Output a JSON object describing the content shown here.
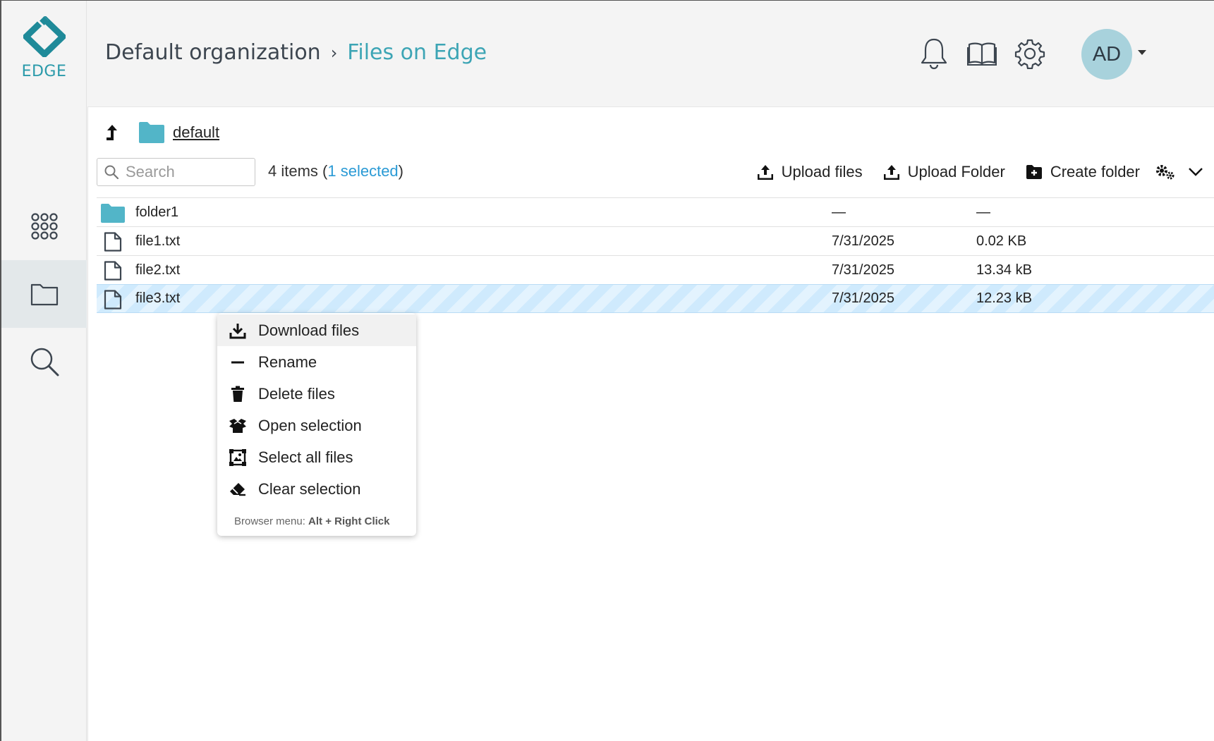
{
  "app": {
    "logo_text": "EDGE",
    "brand_color": "#2a9aaa"
  },
  "sidebar": {
    "items": [
      {
        "icon": "apps-grid-icon",
        "active": false
      },
      {
        "icon": "folder-icon",
        "active": true
      },
      {
        "icon": "search-icon",
        "active": false
      }
    ]
  },
  "header": {
    "breadcrumb_org": "Default organization",
    "breadcrumb_separator": "›",
    "breadcrumb_current": "Files on Edge",
    "icons": [
      "bell-icon",
      "book-icon",
      "gear-icon"
    ],
    "avatar_initials": "AD"
  },
  "pathbar": {
    "folder_name": "default"
  },
  "toolbar": {
    "search_placeholder": "Search",
    "items_count": "4 items",
    "paren_open": "(",
    "selected_label": "1 selected",
    "paren_close": ")",
    "upload_files": "Upload files",
    "upload_folder": "Upload Folder",
    "create_folder": "Create folder"
  },
  "files": [
    {
      "type": "folder",
      "name": "folder1",
      "date": "—",
      "size": "—",
      "selected": false
    },
    {
      "type": "file",
      "name": "file1.txt",
      "date": "7/31/2025",
      "size": "0.02 KB",
      "selected": false
    },
    {
      "type": "file",
      "name": "file2.txt",
      "date": "7/31/2025",
      "size": "13.34 kB",
      "selected": false
    },
    {
      "type": "file",
      "name": "file3.txt",
      "date": "7/31/2025",
      "size": "12.23 kB",
      "selected": true
    }
  ],
  "context_menu": {
    "items": [
      {
        "label": "Download files",
        "icon": "download-icon"
      },
      {
        "label": "Rename",
        "icon": "dash-icon"
      },
      {
        "label": "Delete files",
        "icon": "trash-icon"
      },
      {
        "label": "Open selection",
        "icon": "box-open-icon"
      },
      {
        "label": "Select all files",
        "icon": "select-all-icon"
      },
      {
        "label": "Clear selection",
        "icon": "eraser-icon"
      }
    ],
    "footer_prefix": "Browser menu:",
    "footer_shortcut": "Alt + Right Click"
  }
}
